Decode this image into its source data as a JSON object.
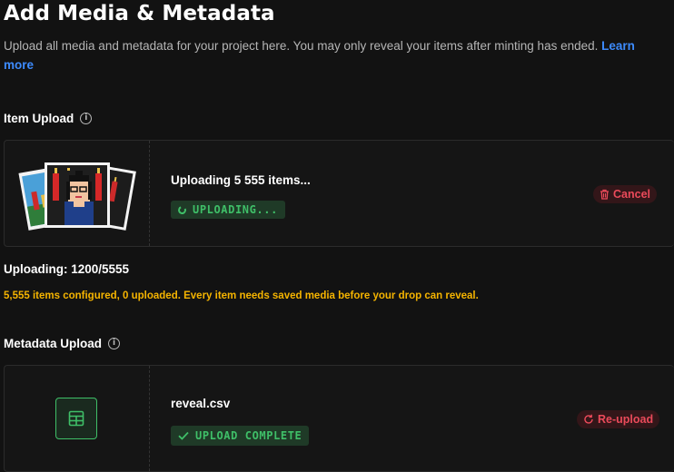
{
  "header": {
    "title": "Add Media & Metadata",
    "description": "Upload all media and metadata for your project here. You may only reveal your items after minting has ended.",
    "learn_more": "Learn more"
  },
  "item_upload": {
    "heading": "Item Upload",
    "card_title": "Uploading 5 555 items...",
    "status": "UPLOADING...",
    "cancel_label": "Cancel",
    "progress_label": "Uploading: 1200/5555",
    "progress": {
      "done": 1200,
      "total": 5555
    },
    "warning": "5,555 items configured, 0 uploaded. Every item needs saved media before your drop can reveal."
  },
  "metadata_upload": {
    "heading": "Metadata Upload",
    "file_name": "reveal.csv",
    "status": "UPLOAD COMPLETE",
    "reupload_label": "Re-upload"
  },
  "colors": {
    "background": "#121212",
    "accent_green": "#3fbf68",
    "danger_red": "#ea4a5a",
    "warning_yellow": "#f5b400",
    "link_blue": "#3d8bfd"
  },
  "icons": [
    "info-icon",
    "trash-icon",
    "spinner-icon",
    "table-icon",
    "check-icon",
    "refresh-icon"
  ]
}
